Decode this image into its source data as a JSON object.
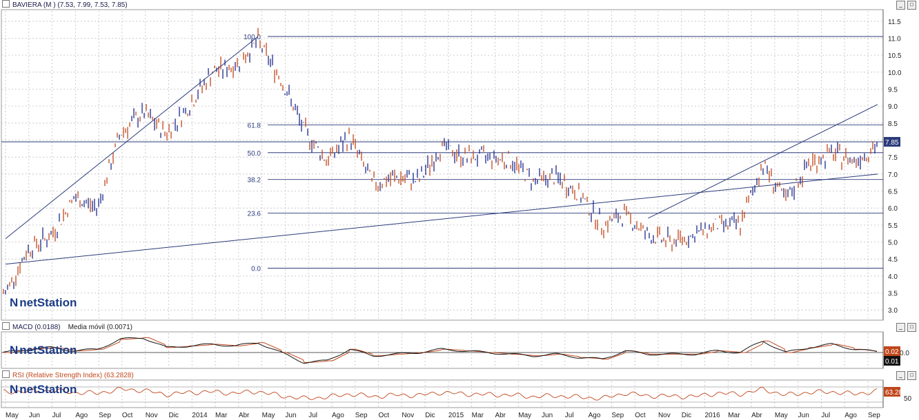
{
  "main_panel": {
    "title": "BAVIERA (M ) (7.53, 7.99, 7.53, 7.85)",
    "last_price_label": "7.85",
    "y_ticks": [
      "3.0",
      "3.5",
      "4.0",
      "4.5",
      "5.0",
      "5.5",
      "6.0",
      "6.5",
      "7.0",
      "7.5",
      "8.0",
      "8.5",
      "9.0",
      "9.5",
      "10.0",
      "10.5",
      "11.0",
      "11.5"
    ],
    "fib_labels": [
      "100.0",
      "61.8",
      "50.0",
      "38.2",
      "23.6",
      "0.0"
    ],
    "logo": "netStation"
  },
  "macd_panel": {
    "title": "MACD (0.0188)",
    "ma_title": "Media móvil (0.0071)",
    "y_tick": "0.0",
    "badge_macd": "0.02",
    "badge_signal": "0.01",
    "logo": "netStation"
  },
  "rsi_panel": {
    "title": "RSI (Relative Strength Index) (63.2828)",
    "y_tick": "50",
    "badge": "63.28",
    "logo": "netStation"
  },
  "x_axis": {
    "labels": [
      "May",
      "Jun",
      "Jul",
      "Ago",
      "Sep",
      "Oct",
      "Nov",
      "Dic",
      "2014",
      "Mar",
      "Abr",
      "May",
      "Jun",
      "Jul",
      "Ago",
      "Sep",
      "Oct",
      "Nov",
      "Dic",
      "2015",
      "Mar",
      "Abr",
      "May",
      "Jun",
      "Jul",
      "Ago",
      "Sep",
      "Oct",
      "Nov",
      "Dic",
      "2016",
      "Mar",
      "Abr",
      "May",
      "Jun",
      "Jul",
      "Ago",
      "Sep"
    ]
  },
  "chart_data": {
    "type": "line",
    "title": "BAVIERA (M )",
    "ohlc_last": {
      "open": 7.53,
      "high": 7.99,
      "low": 7.53,
      "close": 7.85
    },
    "ylim": [
      2.7,
      11.8
    ],
    "grid": true,
    "x": [
      "2013-05",
      "2013-06",
      "2013-07",
      "2013-08",
      "2013-09",
      "2013-10",
      "2013-11",
      "2013-12",
      "2014-01",
      "2014-03",
      "2014-04",
      "2014-05",
      "2014-06",
      "2014-07",
      "2014-08",
      "2014-09",
      "2014-10",
      "2014-11",
      "2014-12",
      "2015-01",
      "2015-03",
      "2015-04",
      "2015-05",
      "2015-06",
      "2015-07",
      "2015-08",
      "2015-09",
      "2015-10",
      "2015-11",
      "2015-12",
      "2016-01",
      "2016-03",
      "2016-04",
      "2016-05",
      "2016-06",
      "2016-07",
      "2016-08",
      "2016-09",
      "2016-10"
    ],
    "series": [
      {
        "values": [
          3.5,
          4.8,
          5.2,
          6.3,
          6.0,
          8.2,
          8.8,
          8.2,
          9.0,
          10.0,
          10.2,
          10.9,
          9.8,
          8.3,
          7.4,
          8.1,
          6.7,
          6.9,
          6.8,
          7.8,
          7.5,
          7.5,
          7.4,
          6.8,
          6.9,
          6.4,
          5.5,
          5.8,
          5.2,
          5.0,
          5.2,
          5.5,
          5.5,
          7.3,
          6.2,
          7.3,
          7.6,
          7.4,
          7.85
        ]
      }
    ],
    "fibonacci": {
      "high": 11.05,
      "low": 4.23,
      "levels": [
        {
          "label": "100.0",
          "value": 11.05
        },
        {
          "label": "61.8",
          "value": 8.45
        },
        {
          "label": "50.0",
          "value": 7.63
        },
        {
          "label": "38.2",
          "value": 6.84
        },
        {
          "label": "23.6",
          "value": 5.85
        },
        {
          "label": "0.0",
          "value": 4.23
        }
      ]
    },
    "horizontal_line": 7.95,
    "trendlines": [
      {
        "from": [
          "2014-05",
          11.05
        ],
        "to": [
          "2016-02",
          5.1
        ]
      },
      {
        "from": [
          "2016-02",
          4.35
        ],
        "to": [
          "2016-10",
          7.0
        ]
      },
      {
        "from": [
          "2015-11",
          5.7
        ],
        "to": [
          "2016-10",
          9.05
        ]
      }
    ],
    "macd": {
      "macd_last": 0.0188,
      "signal_last": 0.0071,
      "values": [
        0.0,
        0.1,
        0.15,
        0.05,
        0.1,
        0.4,
        0.45,
        0.15,
        0.2,
        0.25,
        0.2,
        0.3,
        0.0,
        -0.3,
        -0.25,
        0.1,
        -0.1,
        -0.05,
        0.0,
        0.1,
        0.05,
        0.0,
        -0.05,
        -0.1,
        -0.05,
        -0.15,
        -0.2,
        0.05,
        -0.05,
        -0.05,
        -0.05,
        0.05,
        0.0,
        0.35,
        0.0,
        0.15,
        0.25,
        0.1,
        0.02
      ]
    },
    "rsi": {
      "last": 63.2828,
      "values": [
        60,
        62,
        65,
        58,
        55,
        70,
        66,
        50,
        58,
        60,
        55,
        62,
        45,
        35,
        40,
        52,
        42,
        48,
        47,
        58,
        52,
        50,
        48,
        42,
        45,
        40,
        35,
        55,
        45,
        44,
        42,
        55,
        52,
        70,
        48,
        58,
        60,
        52,
        63.28
      ]
    }
  },
  "colors": {
    "up": "#1b2a8a",
    "down": "#c0461a",
    "grid": "#bfbfbf",
    "fib": "#2a3a7a",
    "macd_signal": "#c0461a",
    "macd": "#111111",
    "badge": "#c0461a"
  }
}
